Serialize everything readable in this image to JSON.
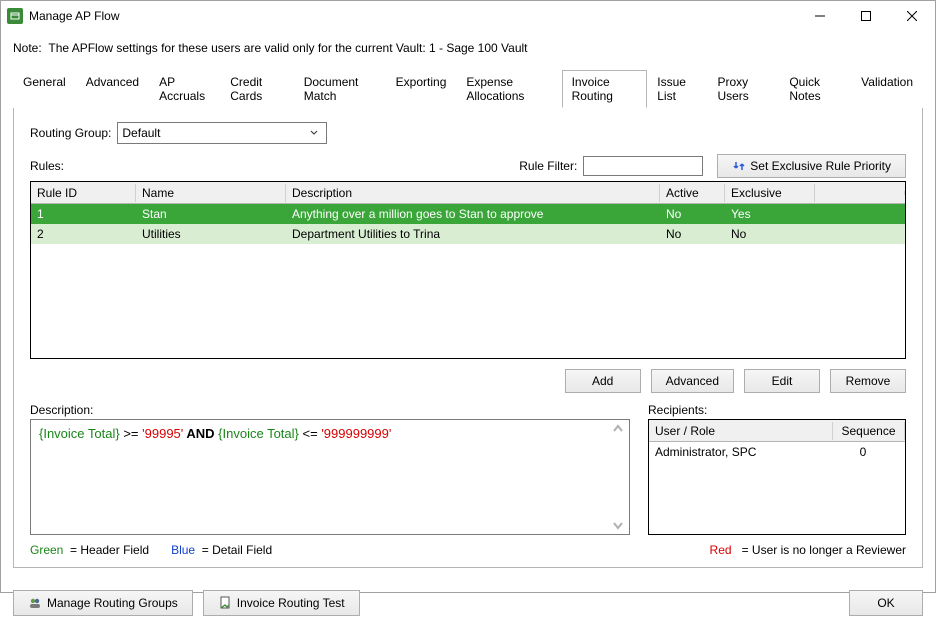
{
  "window": {
    "title": "Manage AP Flow",
    "note_prefix": "Note:",
    "note_text": "The APFlow settings for these users are valid only for the current Vault: 1 - Sage 100 Vault"
  },
  "tabs": {
    "items": [
      "General",
      "Advanced",
      "AP Accruals",
      "Credit Cards",
      "Document Match",
      "Exporting",
      "Expense Allocations",
      "Invoice Routing",
      "Issue List",
      "Proxy Users",
      "Quick Notes",
      "Validation"
    ],
    "active_index": 7
  },
  "routing": {
    "group_label": "Routing Group:",
    "group_value": "Default",
    "rules_label": "Rules:",
    "filter_label": "Rule Filter:",
    "filter_value": "",
    "priority_btn": "Set Exclusive Rule Priority"
  },
  "rules_grid": {
    "columns": {
      "id": "Rule ID",
      "name": "Name",
      "desc": "Description",
      "active": "Active",
      "excl": "Exclusive"
    },
    "rows": [
      {
        "id": "1",
        "name": "Stan",
        "desc": "Anything over a million goes to Stan to approve",
        "active": "No",
        "excl": "Yes",
        "selected": true
      },
      {
        "id": "2",
        "name": "Utilities",
        "desc": "Department Utilities to Trina",
        "active": "No",
        "excl": "No",
        "selected": false
      }
    ],
    "actions": {
      "add": "Add",
      "advanced": "Advanced",
      "edit": "Edit",
      "remove": "Remove"
    }
  },
  "description": {
    "label": "Description:",
    "tok1": "{Invoice Total}",
    "op1": " >= ",
    "val1": "'99995'",
    "and": " AND ",
    "tok2": "{Invoice Total}",
    "op2": " <= ",
    "val2": "'999999999'"
  },
  "recipients": {
    "label": "Recipients:",
    "columns": {
      "user": "User / Role",
      "seq": "Sequence"
    },
    "rows": [
      {
        "user": "Administrator, SPC",
        "seq": "0"
      }
    ]
  },
  "legend": {
    "green_label": "Green",
    "green_desc": "= Header Field",
    "blue_label": "Blue",
    "blue_desc": "= Detail Field",
    "red_label": "Red",
    "red_desc": "= User is no longer a Reviewer"
  },
  "bottom": {
    "manage_groups": "Manage Routing Groups",
    "routing_test": "Invoice Routing Test",
    "ok": "OK"
  }
}
